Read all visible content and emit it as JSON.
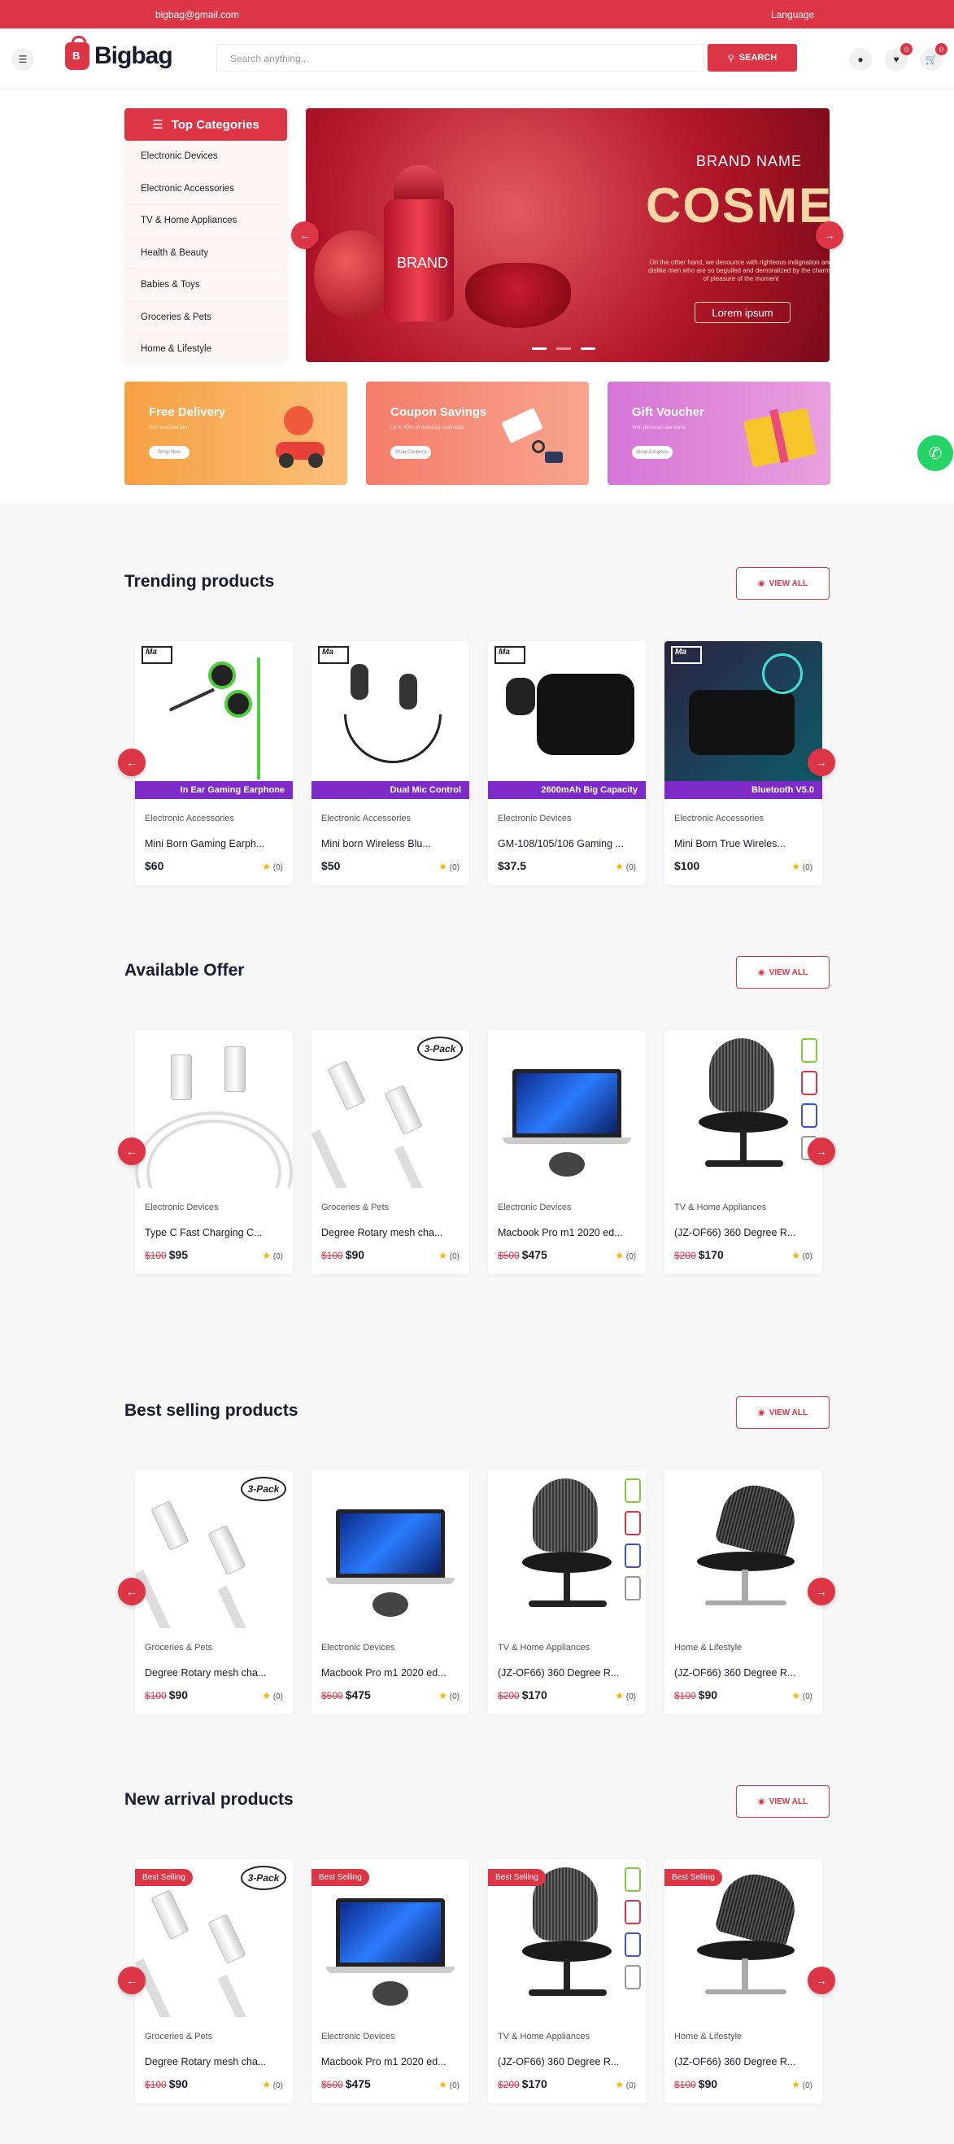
{
  "topbar": {
    "email": "bigbag@gmail.com",
    "language": "Language"
  },
  "header": {
    "logo": "Bigbag",
    "search_placeholder": "Search anything...",
    "search_button": "SEARCH",
    "wishlist_count": "0",
    "cart_count": "0"
  },
  "categories": {
    "title": "Top Categories",
    "items": [
      "Electronic Devices",
      "Electronic Accessories",
      "TV & Home Appliances",
      "Health & Beauty",
      "Babies & Toys",
      "Groceries & Pets",
      "Home & Lifestyle"
    ]
  },
  "banner": {
    "brand": "BRAND NAME",
    "title": "COSMETIC",
    "jar_text": "BRAND",
    "desc": "On the other hand, we denounce with righteous indignation and dislike men who are so beguiled and demoralized by the charms of pleasure of the moment",
    "button": "Lorem ipsum"
  },
  "promos": [
    {
      "title": "Free Delivery",
      "sub": "With selected item",
      "button": "Shop Now",
      "color": "#f9a24b"
    },
    {
      "title": "Coupon Savings",
      "sub": "Up to 40% off everyday essentials",
      "button": "Shop Coupons",
      "color": "#f58a6e"
    },
    {
      "title": "Gift Voucher",
      "sub": "With personal care items",
      "button": "Shop Coupons",
      "color": "#d97fd6"
    }
  ],
  "sections": {
    "view_all": "VIEW ALL",
    "trending": {
      "title": "Trending products",
      "products": [
        {
          "category": "Electronic Accessories",
          "name": "Mini Born Gaming Earph...",
          "price": "$60",
          "old": "",
          "rating": "(0)",
          "banner": "In Ear Gaming Earphone"
        },
        {
          "category": "Electronic Accessories",
          "name": "Mini born Wireless Blu...",
          "price": "$50",
          "old": "",
          "rating": "(0)",
          "banner": "Dual Mic Control"
        },
        {
          "category": "Electronic Devices",
          "name": "GM-108/105/106 Gaming ...",
          "price": "$37.5",
          "old": "",
          "rating": "(0)",
          "banner": "2600mAh Big Capacity"
        },
        {
          "category": "Electronic Accessories",
          "name": "Mini Born True Wireles...",
          "price": "$100",
          "old": "",
          "rating": "(0)",
          "banner": "Bluetooth V5.0"
        }
      ]
    },
    "offer": {
      "title": "Available Offer",
      "products": [
        {
          "category": "Electronic Devices",
          "name": "Type C Fast Charging C...",
          "price": "$95",
          "old": "$100",
          "rating": "(0)"
        },
        {
          "category": "Groceries & Pets",
          "name": "Degree Rotary mesh cha...",
          "price": "$90",
          "old": "$100",
          "rating": "(0)"
        },
        {
          "category": "Electronic Devices",
          "name": "Macbook Pro m1 2020 ed...",
          "price": "$475",
          "old": "$500",
          "rating": "(0)"
        },
        {
          "category": "TV & Home Appliances",
          "name": "(JZ-OF66) 360 Degree R...",
          "price": "$170",
          "old": "$200",
          "rating": "(0)"
        }
      ]
    },
    "bestselling": {
      "title": "Best selling products",
      "products": [
        {
          "category": "Groceries & Pets",
          "name": "Degree Rotary mesh cha...",
          "price": "$90",
          "old": "$100",
          "rating": "(0)"
        },
        {
          "category": "Electronic Devices",
          "name": "Macbook Pro m1 2020 ed...",
          "price": "$475",
          "old": "$500",
          "rating": "(0)"
        },
        {
          "category": "TV & Home Appliances",
          "name": "(JZ-OF66) 360 Degree R...",
          "price": "$170",
          "old": "$200",
          "rating": "(0)"
        },
        {
          "category": "Home & Lifestyle",
          "name": "(JZ-OF66) 360 Degree R...",
          "price": "$90",
          "old": "$100",
          "rating": "(0)"
        }
      ]
    },
    "newarrival": {
      "title": "New arrival products",
      "tag": "Best Selling",
      "products": [
        {
          "category": "Groceries & Pets",
          "name": "Degree Rotary mesh cha...",
          "price": "$90",
          "old": "$100",
          "rating": "(0)"
        },
        {
          "category": "Electronic Devices",
          "name": "Macbook Pro m1 2020 ed...",
          "price": "$475",
          "old": "$500",
          "rating": "(0)"
        },
        {
          "category": "TV & Home Appliances",
          "name": "(JZ-OF66) 360 Degree R...",
          "price": "$170",
          "old": "$200",
          "rating": "(0)"
        },
        {
          "category": "Home & Lifestyle",
          "name": "(JZ-OF66) 360 Degree R...",
          "price": "$90",
          "old": "$100",
          "rating": "(0)"
        }
      ]
    }
  },
  "colors": {
    "accent": "#dc3545",
    "whatsapp": "#25d366"
  }
}
